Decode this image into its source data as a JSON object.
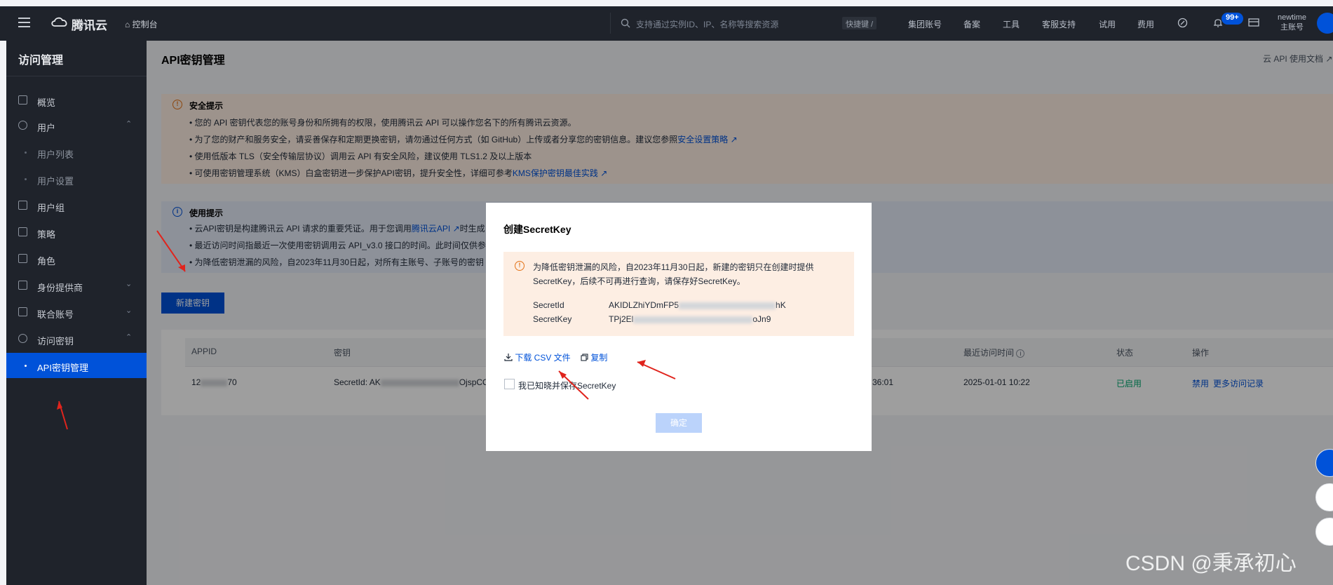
{
  "topbar": {
    "brand": "腾讯云",
    "console": "控制台",
    "search_placeholder": "支持通过实例ID、IP、名称等搜索资源",
    "shortcut": "快捷键 /",
    "nav": [
      "集团账号",
      "备案",
      "工具",
      "客服支持",
      "试用",
      "费用"
    ],
    "notification_badge": "99+",
    "user_name": "newtime",
    "user_role": "主账号"
  },
  "sidebar": {
    "title": "访问管理",
    "items": [
      {
        "label": "概览",
        "icon": "grid-icon"
      },
      {
        "label": "用户",
        "icon": "user-icon",
        "chevron": "⌃"
      },
      {
        "label": "用户列表",
        "sub": true
      },
      {
        "label": "用户设置",
        "sub": true
      },
      {
        "label": "用户组",
        "icon": "users-icon"
      },
      {
        "label": "策略",
        "icon": "policy-icon"
      },
      {
        "label": "角色",
        "icon": "role-icon"
      },
      {
        "label": "身份提供商",
        "icon": "idp-icon",
        "chevron": "⌄"
      },
      {
        "label": "联合账号",
        "icon": "federated-icon",
        "chevron": "⌄"
      },
      {
        "label": "访问密钥",
        "icon": "key-icon",
        "chevron": "⌃"
      },
      {
        "label": "API密钥管理",
        "sub": true,
        "active": true
      }
    ]
  },
  "page": {
    "title": "API密钥管理",
    "doc_link": "云 API 使用文档"
  },
  "security_tip": {
    "title": "安全提示",
    "lines": [
      "您的 API 密钥代表您的账号身份和所拥有的权限，使用腾讯云 API 可以操作您名下的所有腾讯云资源。",
      "为了您的财产和服务安全，请妥善保存和定期更换密钥，请勿通过任何方式（如 GitHub）上传或者分享您的密钥信息。建议您参照",
      "使用低版本 TLS（安全传输层协议）调用云 API 有安全风险，建议使用 TLS1.2 及以上版本",
      "可使用密钥管理系统（KMS）白盒密钥进一步保护API密钥，提升安全性，详细可参考"
    ],
    "link_security_policy": "安全设置策略",
    "link_kms": "KMS保护密钥最佳实践"
  },
  "usage_tip": {
    "title": "使用提示",
    "lines": [
      "云API密钥是构建腾讯云 API 请求的重要凭证。用于您调用",
      "最近访问时间指最近一次使用密钥调用云 API_v3.0 接口的时间。此时间仅供参",
      "为降低密钥泄漏的风险，自2023年11月30日起，对所有主账号、子账号的密钥"
    ],
    "link_api": "腾讯云API",
    "line1_suffix": "时生成"
  },
  "new_key_button": "新建密钥",
  "table": {
    "columns": [
      "APPID",
      "密钥",
      "最近访问时间",
      "状态",
      "操作"
    ],
    "rows": [
      {
        "appid_start": "12",
        "appid_end": "70",
        "secret_prefix": "SecretId: AK",
        "secret_suffix": "OjspCO",
        "created_tail": "36:01",
        "last_access": "2025-01-01 10:22",
        "status": "已启用",
        "action_disable": "禁用",
        "action_records": "更多访问记录"
      }
    ]
  },
  "modal": {
    "title": "创建SecretKey",
    "warning": "为降低密钥泄漏的风险，自2023年11月30日起，新建的密钥只在创建时提供SecretKey，后续不可再进行查询，请保存好SecretKey。",
    "secret_id_label": "SecretId",
    "secret_id_value_start": "AKIDLZhiYDmFP5",
    "secret_id_value_end": "hK",
    "secret_key_label": "SecretKey",
    "secret_key_value_start": "TPj2El",
    "secret_key_value_end": "oJn9",
    "download_csv": "下载 CSV 文件",
    "copy": "复制",
    "acknowledge": "我已知晓并保存SecretKey",
    "confirm": "确定"
  },
  "watermark": "CSDN @秉承初心",
  "colors": {
    "primary": "#0052d9",
    "sidebar_bg": "#1f232b",
    "warning_bg": "#fdeee3",
    "info_bg": "#e4eaf7",
    "status_green": "#00a870",
    "arrow_red": "#e0241d"
  }
}
